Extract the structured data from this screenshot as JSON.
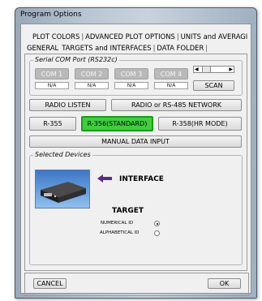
{
  "window": {
    "title": "Program Options"
  },
  "tabs": {
    "row1": [
      "PLOT COLORS",
      "ADVANCED PLOT OPTIONS",
      "UNITS and AVERAGI"
    ],
    "row2": [
      "GENERAL",
      "TARGETS and INTERFACES",
      "DATA FOLDER"
    ]
  },
  "serial_com": {
    "legend": "Serial COM Port (RS232c)",
    "ports": [
      {
        "label": "COM 1",
        "status": "N/A"
      },
      {
        "label": "COM 2",
        "status": "N/A"
      },
      {
        "label": "COM 3",
        "status": "N/A"
      },
      {
        "label": "COM 4",
        "status": "N/A"
      }
    ],
    "scan_label": "SCAN"
  },
  "radio_buttons": {
    "listen": "RADIO LISTEN",
    "network": "RADIO or RS-485 NETWORK"
  },
  "models": {
    "r355": "R-355",
    "r356_standard": "R-356(STANDARD)",
    "r358_hr": "R-358(HR MODE)"
  },
  "manual_input": "MANUAL DATA INPUT",
  "selected_devices": {
    "legend": "Selected Devices",
    "interface_label": "INTERFACE",
    "target_label": "TARGET",
    "options": [
      {
        "label": "NUMERICAL ID",
        "selected": true
      },
      {
        "label": "ALPHABETICAL ID",
        "selected": false
      }
    ]
  },
  "footer": {
    "cancel": "CANCEL",
    "ok": "OK"
  },
  "colors": {
    "selected_model": "#3ecf3e",
    "arrow": "#5b2a86"
  }
}
